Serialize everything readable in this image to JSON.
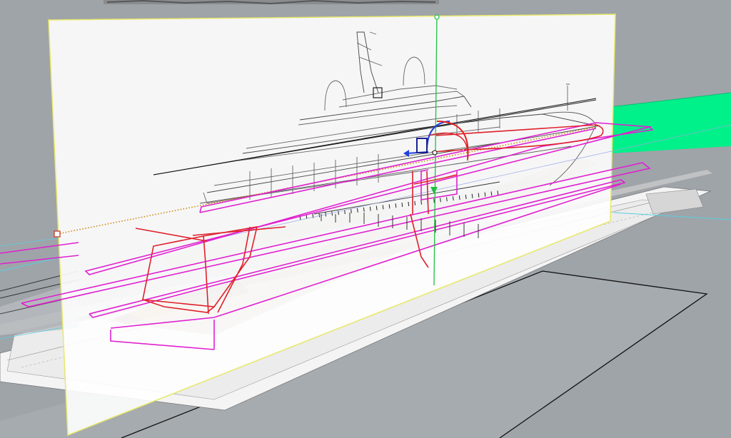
{
  "viewport": {
    "type": "3d-perspective-viewport",
    "background_color": "#9fa4a9",
    "colors": {
      "reference_plane_border": "#e8e86a",
      "reference_plane_fill": "#ffffff",
      "curve_magenta": "#e020d0",
      "curve_red": "#e0202a",
      "gumball_green": "#20c040",
      "gumball_blue": "#2040e0",
      "gumball_red": "#e02020",
      "highlight_green": "#00f08a",
      "drawing_sheet": "#e9e9e9"
    },
    "icons": [
      "gumball-widget-icon",
      "control-point-icon",
      "picture-frame-icon"
    ]
  }
}
